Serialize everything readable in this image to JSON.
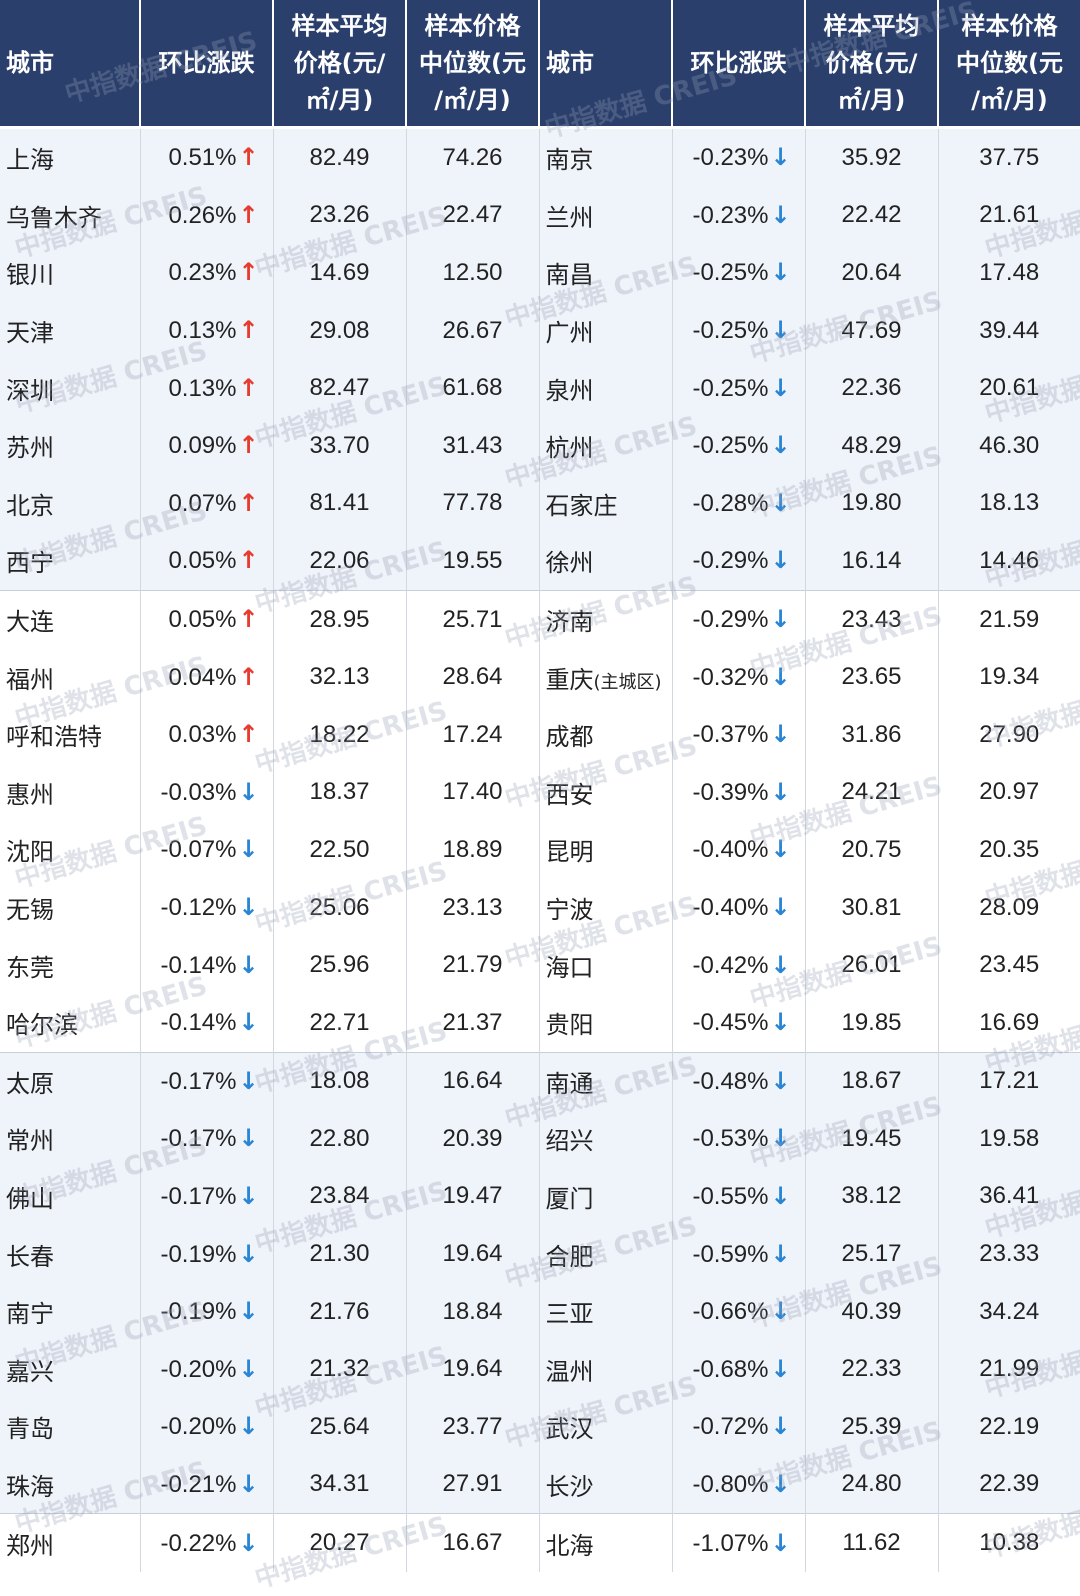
{
  "chart_data": {
    "type": "table",
    "header": {
      "city": "城市",
      "change": "环比涨跌",
      "avg": "样本平均\n价格(元/\n㎡/月)",
      "median": "样本价格\n中位数(元\n/㎡/月)"
    },
    "rows": [
      [
        {
          "city": "上海",
          "change": "0.51%",
          "dir": "up",
          "avg": "82.49",
          "median": "74.26"
        },
        {
          "city": "南京",
          "change": "-0.23%",
          "dir": "down",
          "avg": "35.92",
          "median": "37.75"
        }
      ],
      [
        {
          "city": "乌鲁木齐",
          "change": "0.26%",
          "dir": "up",
          "avg": "23.26",
          "median": "22.47"
        },
        {
          "city": "兰州",
          "change": "-0.23%",
          "dir": "down",
          "avg": "22.42",
          "median": "21.61"
        }
      ],
      [
        {
          "city": "银川",
          "change": "0.23%",
          "dir": "up",
          "avg": "14.69",
          "median": "12.50"
        },
        {
          "city": "南昌",
          "change": "-0.25%",
          "dir": "down",
          "avg": "20.64",
          "median": "17.48"
        }
      ],
      [
        {
          "city": "天津",
          "change": "0.13%",
          "dir": "up",
          "avg": "29.08",
          "median": "26.67"
        },
        {
          "city": "广州",
          "change": "-0.25%",
          "dir": "down",
          "avg": "47.69",
          "median": "39.44"
        }
      ],
      [
        {
          "city": "深圳",
          "change": "0.13%",
          "dir": "up",
          "avg": "82.47",
          "median": "61.68"
        },
        {
          "city": "泉州",
          "change": "-0.25%",
          "dir": "down",
          "avg": "22.36",
          "median": "20.61"
        }
      ],
      [
        {
          "city": "苏州",
          "change": "0.09%",
          "dir": "up",
          "avg": "33.70",
          "median": "31.43"
        },
        {
          "city": "杭州",
          "change": "-0.25%",
          "dir": "down",
          "avg": "48.29",
          "median": "46.30"
        }
      ],
      [
        {
          "city": "北京",
          "change": "0.07%",
          "dir": "up",
          "avg": "81.41",
          "median": "77.78"
        },
        {
          "city": "石家庄",
          "change": "-0.28%",
          "dir": "down",
          "avg": "19.80",
          "median": "18.13"
        }
      ],
      [
        {
          "city": "西宁",
          "change": "0.05%",
          "dir": "up",
          "avg": "22.06",
          "median": "19.55"
        },
        {
          "city": "徐州",
          "change": "-0.29%",
          "dir": "down",
          "avg": "16.14",
          "median": "14.46"
        }
      ],
      [
        {
          "city": "大连",
          "change": "0.05%",
          "dir": "up",
          "avg": "28.95",
          "median": "25.71"
        },
        {
          "city": "济南",
          "change": "-0.29%",
          "dir": "down",
          "avg": "23.43",
          "median": "21.59"
        }
      ],
      [
        {
          "city": "福州",
          "change": "0.04%",
          "dir": "up",
          "avg": "32.13",
          "median": "28.64"
        },
        {
          "city": "重庆",
          "city_note": "(主城区)",
          "change": "-0.32%",
          "dir": "down",
          "avg": "23.65",
          "median": "19.34"
        }
      ],
      [
        {
          "city": "呼和浩特",
          "change": "0.03%",
          "dir": "up",
          "avg": "18.22",
          "median": "17.24"
        },
        {
          "city": "成都",
          "change": "-0.37%",
          "dir": "down",
          "avg": "31.86",
          "median": "27.90"
        }
      ],
      [
        {
          "city": "惠州",
          "change": "-0.03%",
          "dir": "down",
          "avg": "18.37",
          "median": "17.40"
        },
        {
          "city": "西安",
          "change": "-0.39%",
          "dir": "down",
          "avg": "24.21",
          "median": "20.97"
        }
      ],
      [
        {
          "city": "沈阳",
          "change": "-0.07%",
          "dir": "down",
          "avg": "22.50",
          "median": "18.89"
        },
        {
          "city": "昆明",
          "change": "-0.40%",
          "dir": "down",
          "avg": "20.75",
          "median": "20.35"
        }
      ],
      [
        {
          "city": "无锡",
          "change": "-0.12%",
          "dir": "down",
          "avg": "25.06",
          "median": "23.13"
        },
        {
          "city": "宁波",
          "change": "-0.40%",
          "dir": "down",
          "avg": "30.81",
          "median": "28.09"
        }
      ],
      [
        {
          "city": "东莞",
          "change": "-0.14%",
          "dir": "down",
          "avg": "25.96",
          "median": "21.79"
        },
        {
          "city": "海口",
          "change": "-0.42%",
          "dir": "down",
          "avg": "26.01",
          "median": "23.45"
        }
      ],
      [
        {
          "city": "哈尔滨",
          "change": "-0.14%",
          "dir": "down",
          "avg": "22.71",
          "median": "21.37"
        },
        {
          "city": "贵阳",
          "change": "-0.45%",
          "dir": "down",
          "avg": "19.85",
          "median": "16.69"
        }
      ],
      [
        {
          "city": "太原",
          "change": "-0.17%",
          "dir": "down",
          "avg": "18.08",
          "median": "16.64"
        },
        {
          "city": "南通",
          "change": "-0.48%",
          "dir": "down",
          "avg": "18.67",
          "median": "17.21"
        }
      ],
      [
        {
          "city": "常州",
          "change": "-0.17%",
          "dir": "down",
          "avg": "22.80",
          "median": "20.39"
        },
        {
          "city": "绍兴",
          "change": "-0.53%",
          "dir": "down",
          "avg": "19.45",
          "median": "19.58"
        }
      ],
      [
        {
          "city": "佛山",
          "change": "-0.17%",
          "dir": "down",
          "avg": "23.84",
          "median": "19.47"
        },
        {
          "city": "厦门",
          "change": "-0.55%",
          "dir": "down",
          "avg": "38.12",
          "median": "36.41"
        }
      ],
      [
        {
          "city": "长春",
          "change": "-0.19%",
          "dir": "down",
          "avg": "21.30",
          "median": "19.64"
        },
        {
          "city": "合肥",
          "change": "-0.59%",
          "dir": "down",
          "avg": "25.17",
          "median": "23.33"
        }
      ],
      [
        {
          "city": "南宁",
          "change": "-0.19%",
          "dir": "down",
          "avg": "21.76",
          "median": "18.84"
        },
        {
          "city": "三亚",
          "change": "-0.66%",
          "dir": "down",
          "avg": "40.39",
          "median": "34.24"
        }
      ],
      [
        {
          "city": "嘉兴",
          "change": "-0.20%",
          "dir": "down",
          "avg": "21.32",
          "median": "19.64"
        },
        {
          "city": "温州",
          "change": "-0.68%",
          "dir": "down",
          "avg": "22.33",
          "median": "21.99"
        }
      ],
      [
        {
          "city": "青岛",
          "change": "-0.20%",
          "dir": "down",
          "avg": "25.64",
          "median": "23.77"
        },
        {
          "city": "武汉",
          "change": "-0.72%",
          "dir": "down",
          "avg": "25.39",
          "median": "22.19"
        }
      ],
      [
        {
          "city": "珠海",
          "change": "-0.21%",
          "dir": "down",
          "avg": "34.31",
          "median": "27.91"
        },
        {
          "city": "长沙",
          "change": "-0.80%",
          "dir": "down",
          "avg": "24.80",
          "median": "22.39"
        }
      ],
      [
        {
          "city": "郑州",
          "change": "-0.22%",
          "dir": "down",
          "avg": "20.27",
          "median": "16.67"
        },
        {
          "city": "北海",
          "change": "-1.07%",
          "dir": "down",
          "avg": "11.62",
          "median": "10.38"
        }
      ]
    ]
  },
  "watermark": "中指数据 CREIS",
  "arrows": {
    "up": "↑",
    "down": "↓"
  },
  "colors": {
    "header_bg": "#2a3f6c",
    "band_a": "#eff3fa",
    "band_b": "#ffffff",
    "up_arrow": "#e63b2e",
    "down_arrow": "#2a86d4"
  }
}
